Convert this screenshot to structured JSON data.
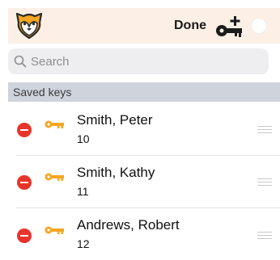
{
  "nav": {
    "done_label": "Done"
  },
  "search": {
    "placeholder": "Search",
    "value": ""
  },
  "section": {
    "title": "Saved keys"
  },
  "keys": [
    {
      "name": "Smith, Peter",
      "number": "10"
    },
    {
      "name": "Smith, Kathy",
      "number": "11"
    },
    {
      "name": "Andrews, Robert",
      "number": "12"
    }
  ],
  "icons": {
    "logo": "fox-logo-icon",
    "add_key": "add-key-icon",
    "search": "search-icon",
    "delete": "delete-icon",
    "key": "key-icon",
    "reorder": "drag-handle-icon"
  },
  "colors": {
    "accent_orange": "#f5a623",
    "delete_red": "#e8342a",
    "nav_bg": "#fcf0e6",
    "section_bg": "#cfd3dc"
  }
}
